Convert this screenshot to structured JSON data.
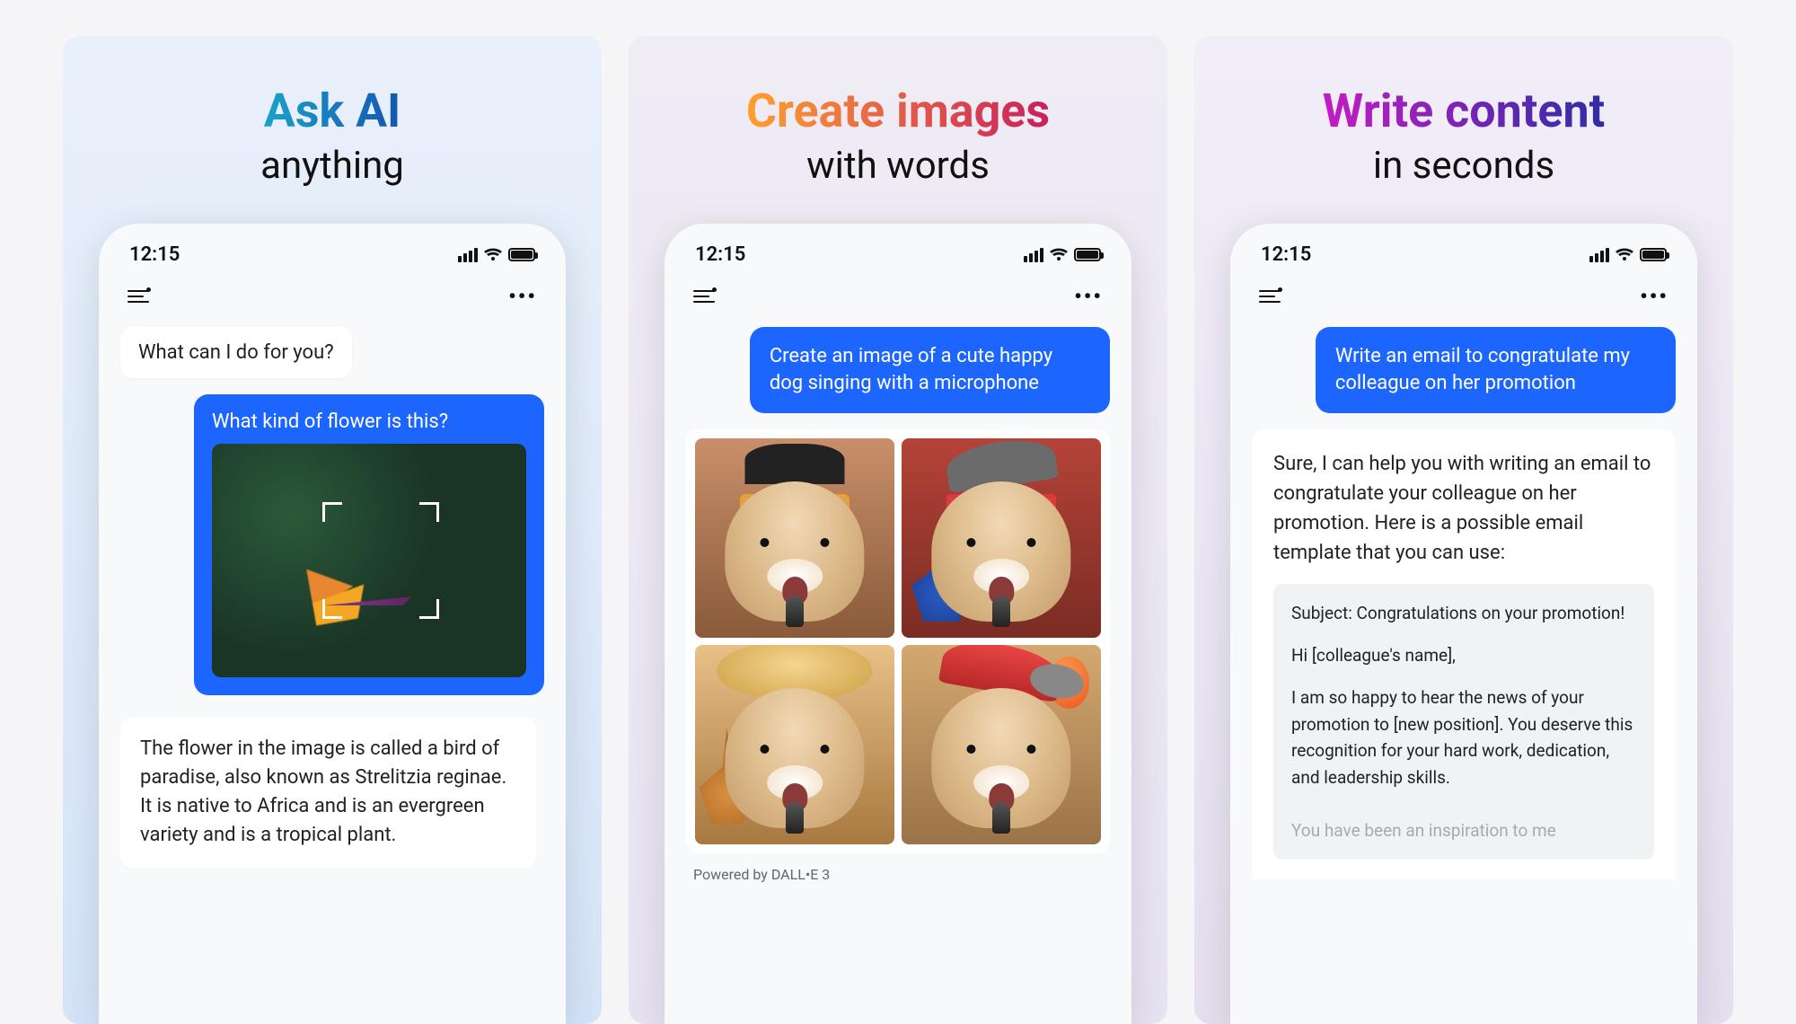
{
  "statusbar": {
    "time": "12:15"
  },
  "panels": [
    {
      "headline": "Ask AI",
      "sub": "anything",
      "ai_greeting": "What can I do for you?",
      "user_question": "What kind of flower is this?",
      "ai_answer": "The flower in the image is called a bird of paradise, also known as Strelitzia reginae. It is native to Africa and is an evergreen variety and is a tropical plant."
    },
    {
      "headline": "Create images",
      "sub": "with words",
      "user_prompt": "Create an image of a cute happy dog singing with a microphone",
      "powered": "Powered by DALL•E 3"
    },
    {
      "headline": "Write content",
      "sub": "in seconds",
      "user_prompt": "Write an email to congratulate my colleague on her promotion",
      "ai_intro": "Sure, I can help you with writing an email to congratulate your colleague on her promotion. Here is a possible email template that you can use:",
      "email": {
        "subject": "Subject: Congratulations on your promotion!",
        "greeting": "Hi [colleague's name],",
        "body": "I am so happy to hear the news of your promotion to [new position]. You deserve this recognition for your hard work, dedication, and leadership skills.",
        "fade": "You have been an inspiration to me"
      }
    }
  ]
}
